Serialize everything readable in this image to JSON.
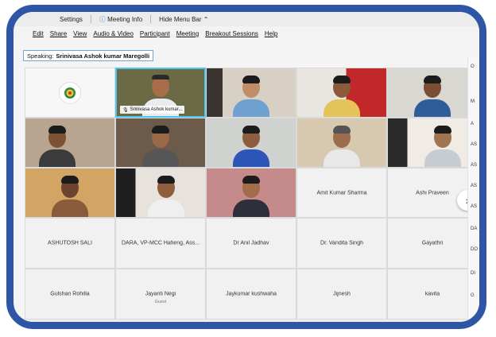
{
  "menubar": {
    "settings": "Settings",
    "meeting_info": "Meeting Info",
    "hide_menu_bar": "Hide Menu Bar"
  },
  "menus": [
    "Edit",
    "Share",
    "View",
    "Audio & Video",
    "Participant",
    "Meeting",
    "Breakout Sessions",
    "Help"
  ],
  "speaking": {
    "label": "Speaking:",
    "name": "Srinivasa Ashok kumar Maregolli"
  },
  "active_caption": "Srinivasa Ashok kumar...",
  "named_tiles": [
    {
      "name": "Amit Kumar Sharma",
      "sub": ""
    },
    {
      "name": "Ashi Praveen",
      "sub": ""
    },
    {
      "name": "ASHUTOSH SALI",
      "sub": ""
    },
    {
      "name": "DARA, VP-MCC Hafieng, Ass...",
      "sub": ""
    },
    {
      "name": "Dr Anil Jadhav",
      "sub": ""
    },
    {
      "name": "Dr. Vandita Singh",
      "sub": ""
    },
    {
      "name": "Gayathri",
      "sub": ""
    },
    {
      "name": "Gulshan Rohilla",
      "sub": ""
    },
    {
      "name": "Jayanti Negi",
      "sub": "Guest"
    },
    {
      "name": "Jaykumar kushwaha",
      "sub": ""
    },
    {
      "name": "Jijnesh",
      "sub": ""
    },
    {
      "name": "kavita",
      "sub": ""
    }
  ],
  "side_letters": [
    "O",
    "M",
    "A",
    "AS",
    "AS",
    "AS",
    "AS",
    "DA",
    "DO",
    "DI",
    "G"
  ],
  "icons": {
    "next": "chevron-right-icon",
    "logo": "org-logo-icon",
    "mic": "mic-icon"
  },
  "colors": {
    "frame": "#2f56a6",
    "active_border": "#4cc6f0"
  }
}
